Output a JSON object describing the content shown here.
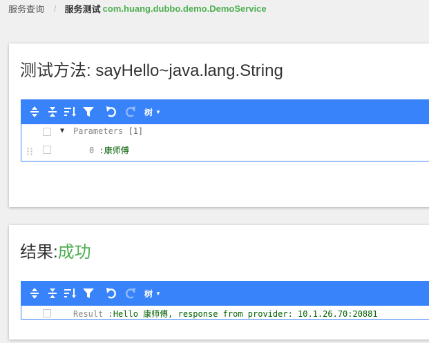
{
  "breadcrumb": {
    "query": "服务查询",
    "separator": "/",
    "current": "服务测试",
    "service": "com.huang.dubbo.demo.DemoService"
  },
  "method_card": {
    "title": "测试方法: sayHello~java.lang.String",
    "editor": {
      "toolbar": {
        "expand_all": "expand-all-icon",
        "collapse_all": "collapse-all-icon",
        "sort": "sort-icon",
        "filter": "filter-icon",
        "undo": "undo-icon",
        "redo": "redo-icon",
        "mode_label": "树"
      },
      "root": {
        "field": "Parameters",
        "count": "[1]"
      },
      "items": [
        {
          "index": "0",
          "separator": ":",
          "value": "康师傅"
        }
      ]
    }
  },
  "result_card": {
    "title_prefix": "结果:",
    "status": "成功",
    "editor": {
      "toolbar": {
        "mode_label": "树"
      },
      "result": {
        "field": "Result",
        "separator": ":",
        "value": "Hello 康师傅, response from provider: 10.1.26.70:20881"
      }
    }
  },
  "colors": {
    "toolbar_bg": "#3883fa",
    "accent_green": "#4caf50",
    "string_value": "#006000"
  }
}
